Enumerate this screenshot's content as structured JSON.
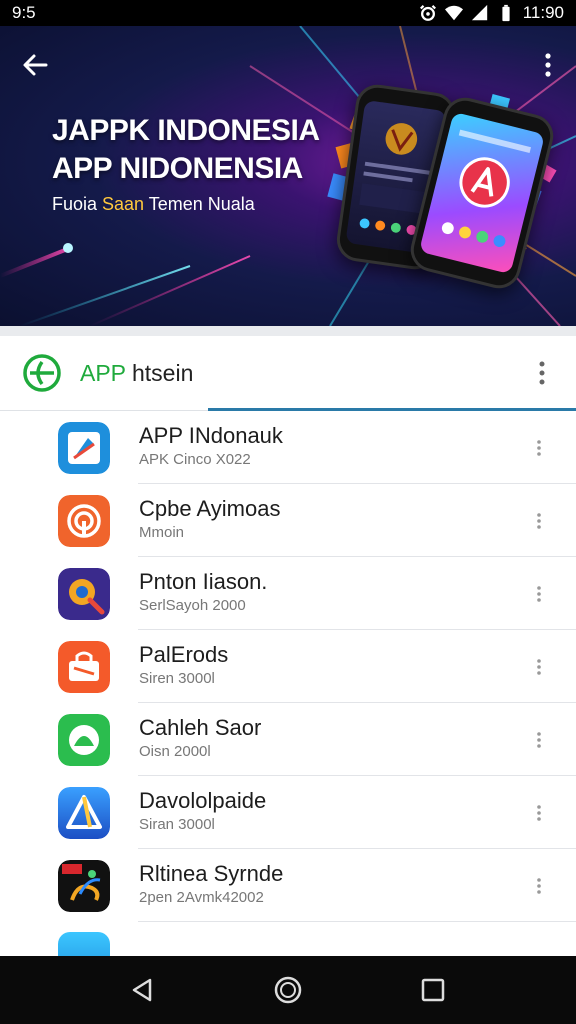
{
  "status_bar": {
    "time": "9:5",
    "clock": "11:90",
    "icons": [
      "alarm-icon",
      "wifi-icon",
      "signal-icon",
      "battery-icon"
    ]
  },
  "hero": {
    "title_line1": "JAPPK INDONESIA",
    "title_line2": "APP NIDONENSIA",
    "subtitle_prefix": "Fuoia ",
    "subtitle_highlight": "Saan",
    "subtitle_suffix": " Temen Nuala",
    "icons": [
      "back-arrow-icon",
      "more-vert-icon"
    ]
  },
  "list_header": {
    "title_green": "APP",
    "title_rest": " htsein"
  },
  "apps": [
    {
      "title": "APP INdonauk",
      "subtitle": "APK Cinco X022",
      "icon": "compass-app-icon",
      "color": "#1e8fdc"
    },
    {
      "title": "Cpbe Ayimoas",
      "subtitle": "Mmoin",
      "icon": "podcast-app-icon",
      "color": "#f0642c"
    },
    {
      "title": "Pnton Iiason.",
      "subtitle": "SerlSayoh 2000",
      "icon": "gear-search-app-icon",
      "color": "#3a2a8c"
    },
    {
      "title": "PalErods",
      "subtitle": "Siren 3000l",
      "icon": "bag-app-icon",
      "color": "#f45a2a"
    },
    {
      "title": "Cahleh Saor",
      "subtitle": "Oisn 2000l",
      "icon": "dome-app-icon",
      "color": "#2bbd4e"
    },
    {
      "title": "Davololpaide",
      "subtitle": "Siran 3000l",
      "icon": "triangle-app-icon",
      "color": "#2a6fd8"
    },
    {
      "title": "Rltinea Syrnde",
      "subtitle": "2pen 2Avmk42002",
      "icon": "dragon-app-icon",
      "color": "#111111"
    }
  ],
  "nav_bar": {
    "icons": [
      "back-triangle-icon",
      "home-circle-icon",
      "recents-square-icon"
    ]
  }
}
